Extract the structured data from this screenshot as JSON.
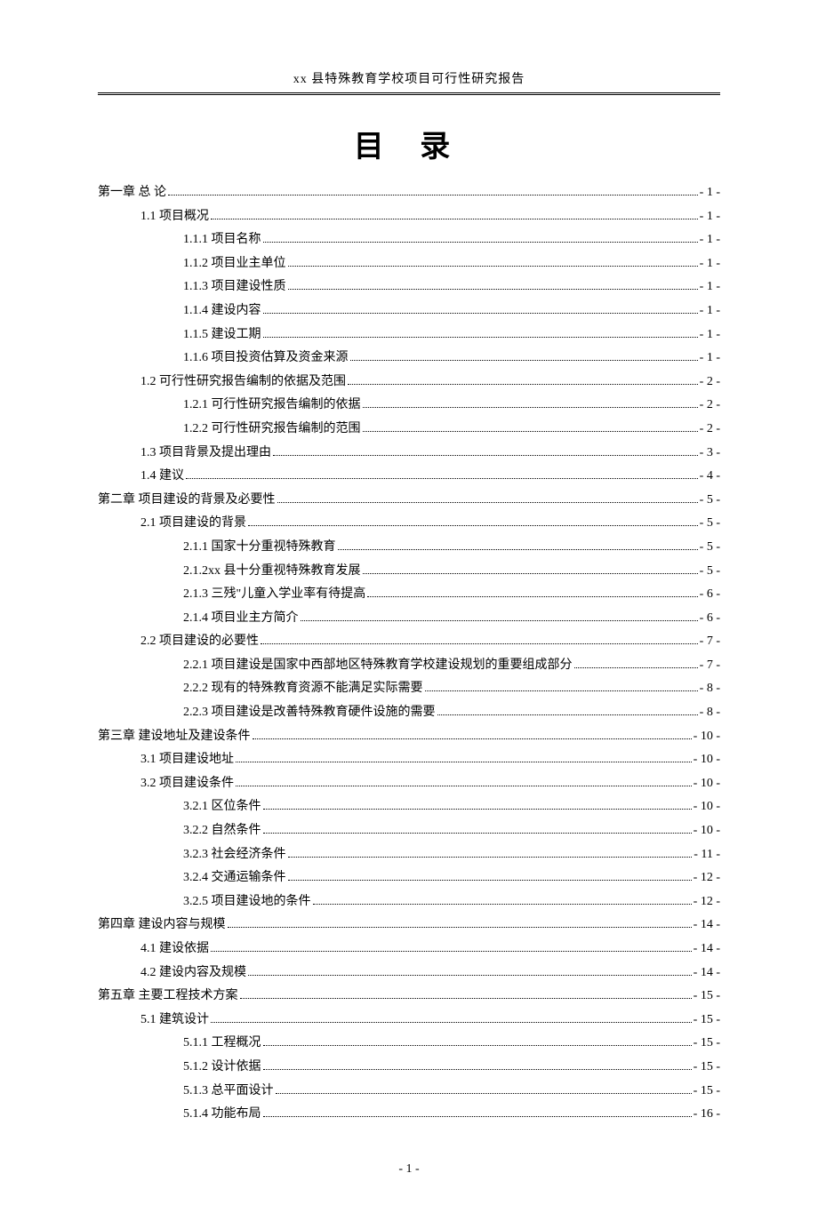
{
  "header": "xx 县特殊教育学校项目可行性研究报告",
  "title": "目  录",
  "footer": "- 1 -",
  "toc": [
    {
      "level": 1,
      "label": "第一章  总  论",
      "page": "- 1 -"
    },
    {
      "level": 2,
      "label": "1.1 项目概况",
      "page": "- 1 -"
    },
    {
      "level": 3,
      "label": "1.1.1 项目名称",
      "page": "- 1 -"
    },
    {
      "level": 3,
      "label": "1.1.2 项目业主单位",
      "page": "- 1 -"
    },
    {
      "level": 3,
      "label": "1.1.3 项目建设性质",
      "page": "- 1 -"
    },
    {
      "level": 3,
      "label": "1.1.4 建设内容",
      "page": "- 1 -"
    },
    {
      "level": 3,
      "label": "1.1.5 建设工期",
      "page": "- 1 -"
    },
    {
      "level": 3,
      "label": "1.1.6 项目投资估算及资金来源",
      "page": "- 1 -"
    },
    {
      "level": 2,
      "label": "1.2 可行性研究报告编制的依据及范围",
      "page": "- 2 -"
    },
    {
      "level": 3,
      "label": "1.2.1 可行性研究报告编制的依据",
      "page": "- 2 -"
    },
    {
      "level": 3,
      "label": "1.2.2  可行性研究报告编制的范围",
      "page": "- 2 -"
    },
    {
      "level": 2,
      "label": "1.3 项目背景及提出理由",
      "page": "- 3 -"
    },
    {
      "level": 2,
      "label": "1.4 建议",
      "page": "- 4 -"
    },
    {
      "level": 1,
      "label": "第二章  项目建设的背景及必要性",
      "page": "- 5 -"
    },
    {
      "level": 2,
      "label": "2.1 项目建设的背景",
      "page": "- 5 -"
    },
    {
      "level": 3,
      "label": "2.1.1 国家十分重视特殊教育",
      "page": "- 5 -"
    },
    {
      "level": 3,
      "label": "2.1.2xx 县十分重视特殊教育发展",
      "page": "- 5 -"
    },
    {
      "level": 3,
      "label": "2.1.3 三残\"儿童入学业率有待提高",
      "page": "- 6 -"
    },
    {
      "level": 3,
      "label": "2.1.4 项目业主方简介",
      "page": "- 6 -"
    },
    {
      "level": 2,
      "label": "2.2 项目建设的必要性",
      "page": "- 7 -"
    },
    {
      "level": 3,
      "label": "2.2.1 项目建设是国家中西部地区特殊教育学校建设规划的重要组成部分",
      "page": "- 7 -"
    },
    {
      "level": 3,
      "label": "2.2.2 现有的特殊教育资源不能满足实际需要",
      "page": "- 8 -"
    },
    {
      "level": 3,
      "label": "2.2.3 项目建设是改善特殊教育硬件设施的需要",
      "page": "- 8 -"
    },
    {
      "level": 1,
      "label": "第三章 建设地址及建设条件",
      "page": "- 10 -"
    },
    {
      "level": 2,
      "label": "3.1 项目建设地址",
      "page": "- 10 -"
    },
    {
      "level": 2,
      "label": "3.2 项目建设条件",
      "page": "- 10 -"
    },
    {
      "level": 3,
      "label": "3.2.1 区位条件",
      "page": "- 10 -"
    },
    {
      "level": 3,
      "label": "3.2.2 自然条件",
      "page": "- 10 -"
    },
    {
      "level": 3,
      "label": "3.2.3 社会经济条件",
      "page": "- 11 -"
    },
    {
      "level": 3,
      "label": "3.2.4 交通运输条件",
      "page": "- 12 -"
    },
    {
      "level": 3,
      "label": "3.2.5 项目建设地的条件",
      "page": "- 12 -"
    },
    {
      "level": 1,
      "label": "第四章 建设内容与规模",
      "page": "- 14 -"
    },
    {
      "level": 2,
      "label": "4.1 建设依据",
      "page": "- 14 -"
    },
    {
      "level": 2,
      "label": "4.2 建设内容及规模",
      "page": "- 14 -"
    },
    {
      "level": 1,
      "label": "第五章   主要工程技术方案",
      "page": "- 15 -"
    },
    {
      "level": 2,
      "label": "5.1 建筑设计",
      "page": "- 15 -"
    },
    {
      "level": 3,
      "label": "5.1.1 工程概况",
      "page": "- 15 -"
    },
    {
      "level": 3,
      "label": "5.1.2 设计依据",
      "page": "- 15 -"
    },
    {
      "level": 3,
      "label": "5.1.3 总平面设计",
      "page": "- 15 -"
    },
    {
      "level": 3,
      "label": "5.1.4 功能布局",
      "page": "- 16 -"
    }
  ]
}
